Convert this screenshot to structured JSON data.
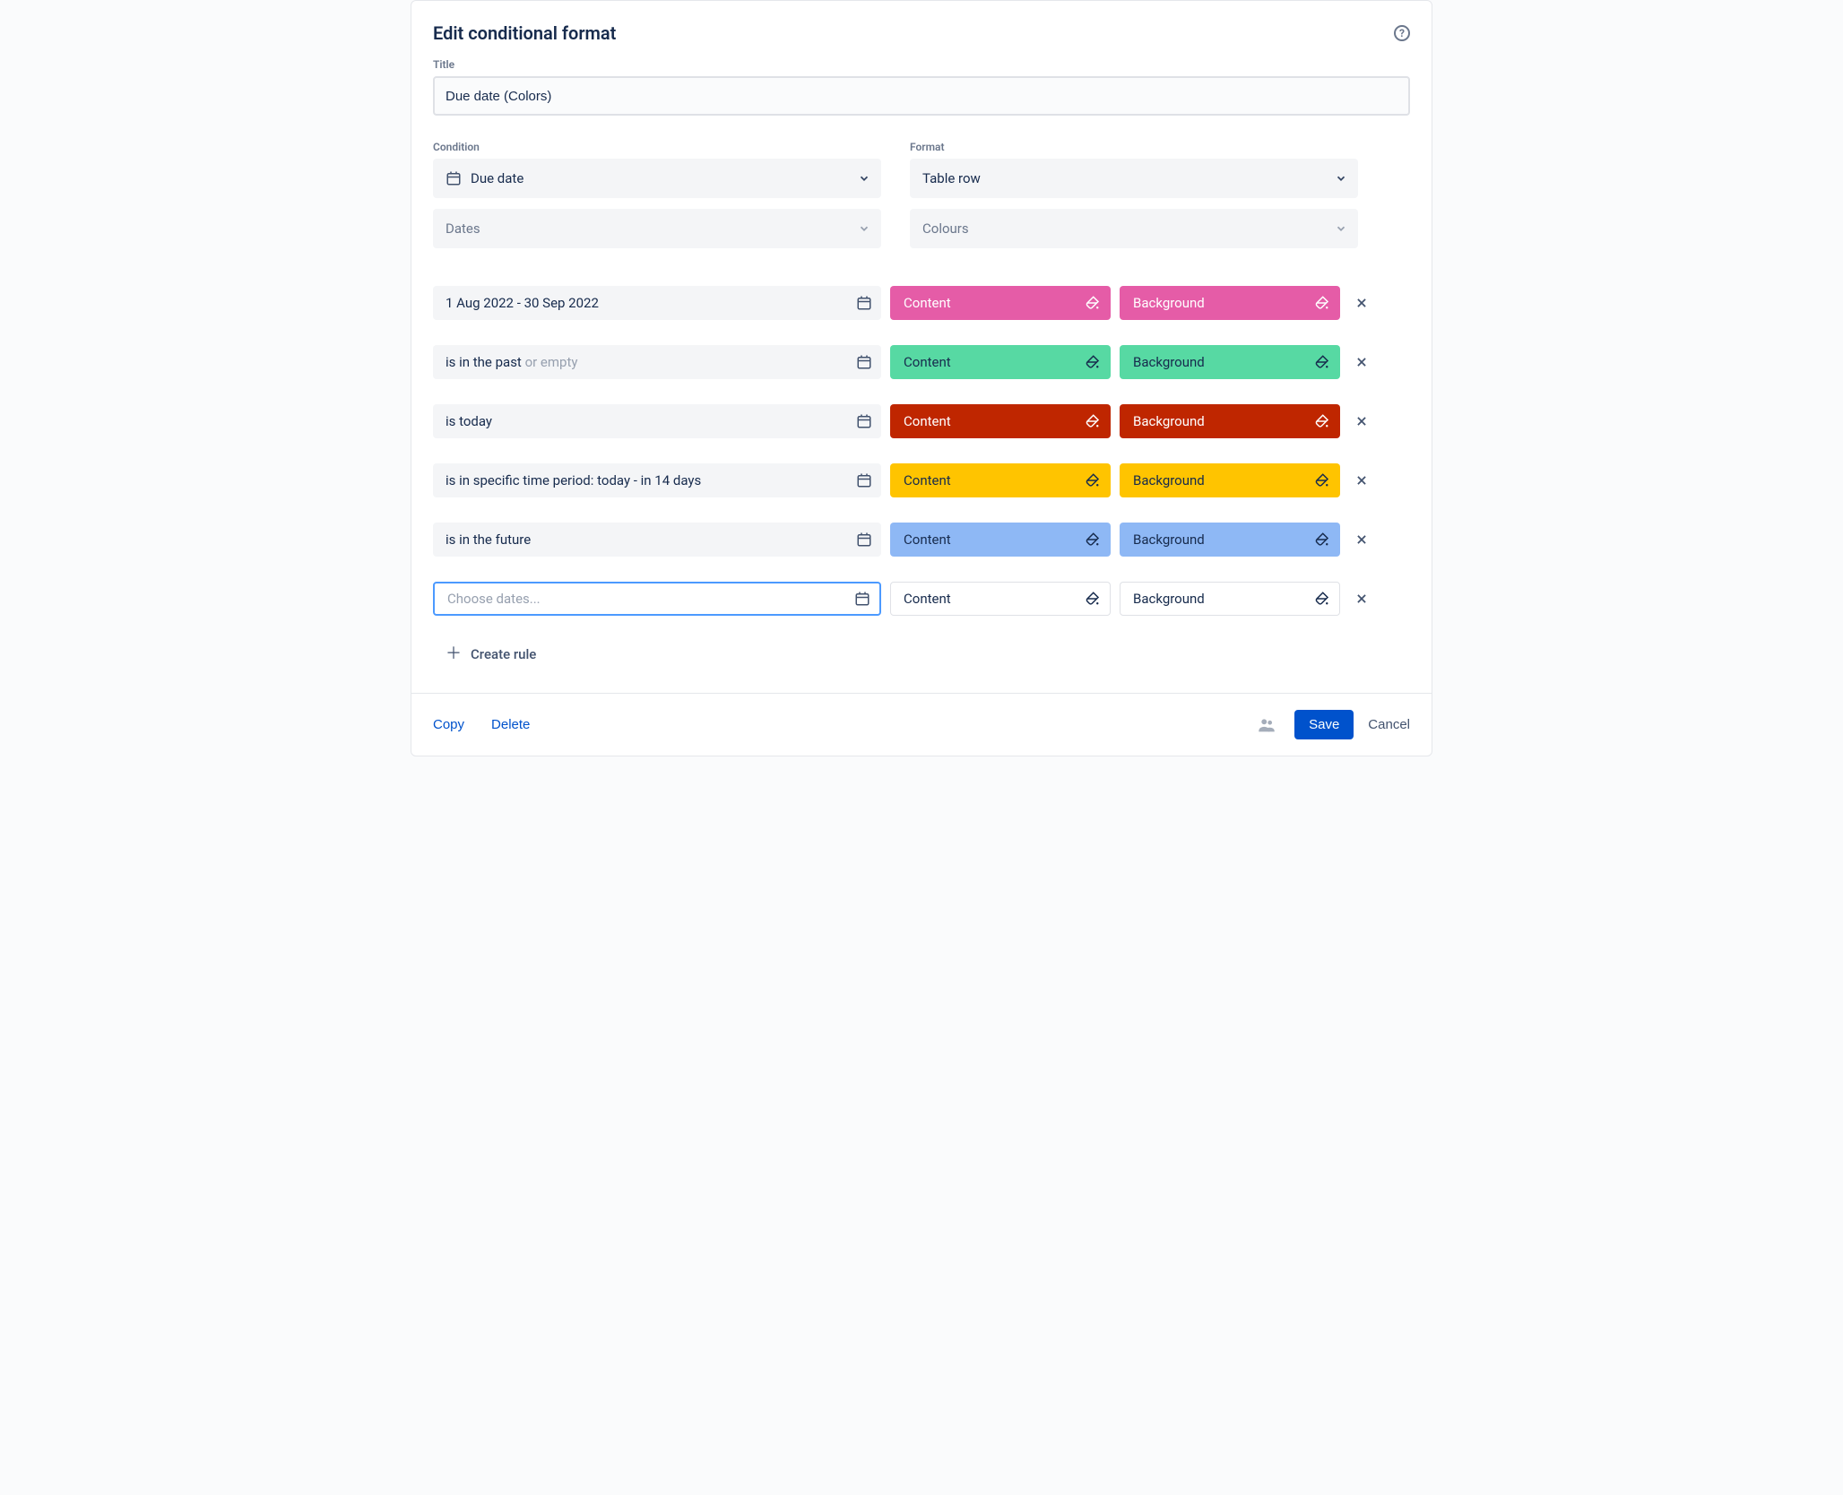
{
  "header": {
    "title": "Edit conditional format"
  },
  "labels": {
    "title": "Title",
    "condition": "Condition",
    "format": "Format"
  },
  "title_value": "Due date (Colors)",
  "condition": {
    "field": "Due date",
    "type": "Dates"
  },
  "format": {
    "scope": "Table row",
    "style": "Colours"
  },
  "chip_labels": {
    "content": "Content",
    "background": "Background"
  },
  "colors": {
    "pink": {
      "bg": "#E55CA7",
      "fg": "#FFFFFF"
    },
    "green": {
      "bg": "#57D9A3",
      "fg": "#172B4D"
    },
    "red": {
      "bg": "#BF2600",
      "fg": "#FFFFFF"
    },
    "yellow": {
      "bg": "#FFC400",
      "fg": "#172B4D"
    },
    "blue": {
      "bg": "#8EB8F5",
      "fg": "#172B4D"
    },
    "white": {
      "bg": "#FFFFFF",
      "fg": "#172B4D"
    }
  },
  "rules": [
    {
      "text": "1 Aug 2022 - 30 Sep 2022",
      "suffix": "",
      "color": "pink",
      "active": false
    },
    {
      "text": "is in the past ",
      "suffix": "or empty",
      "color": "green",
      "active": false
    },
    {
      "text": "is today",
      "suffix": "",
      "color": "red",
      "active": false
    },
    {
      "text": "is in specific time period: today - in 14 days",
      "suffix": "",
      "color": "yellow",
      "active": false
    },
    {
      "text": "is in the future",
      "suffix": "",
      "color": "blue",
      "active": false
    },
    {
      "text": "",
      "suffix": "",
      "color": "white",
      "active": true,
      "placeholder": "Choose dates..."
    }
  ],
  "actions": {
    "create_rule": "Create rule",
    "copy": "Copy",
    "delete": "Delete",
    "save": "Save",
    "cancel": "Cancel"
  }
}
